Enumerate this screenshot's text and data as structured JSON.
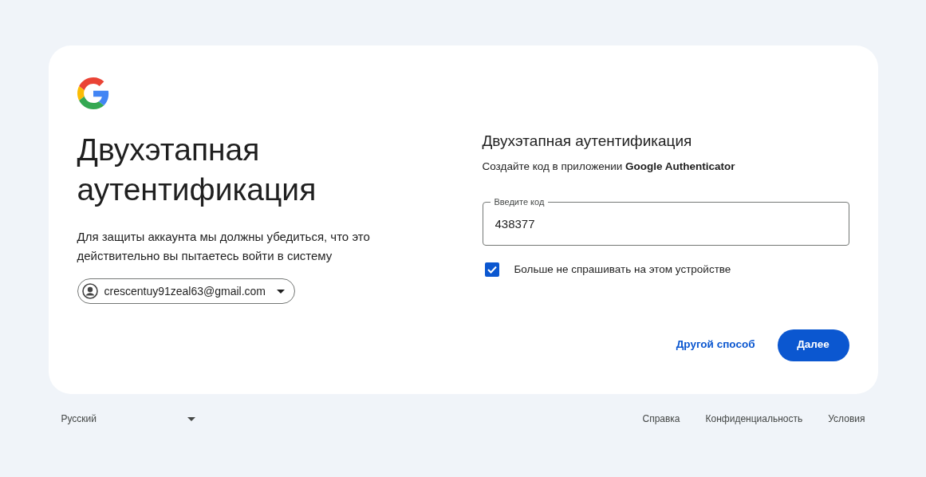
{
  "heading": "Двухэтапная аутентификация",
  "description": "Для защиты аккаунта мы должны убедиться, что это действительно вы пытаетесь войти в систему",
  "account": {
    "email": "crescentuy91zeal63@gmail.com"
  },
  "form": {
    "title": "Двухэтапная аутентификация",
    "subtitle": "Создайте код в приложении **Google Authenticator**",
    "code_field": {
      "label": "Введите код",
      "value": "438377"
    },
    "remember": {
      "label": "Больше не спрашивать на этом устройстве",
      "checked": true
    }
  },
  "buttons": {
    "alternate": "Другой способ",
    "next": "Далее"
  },
  "footer": {
    "language": "Русский",
    "links": [
      "Справка",
      "Конфиденциальность",
      "Условия"
    ]
  }
}
